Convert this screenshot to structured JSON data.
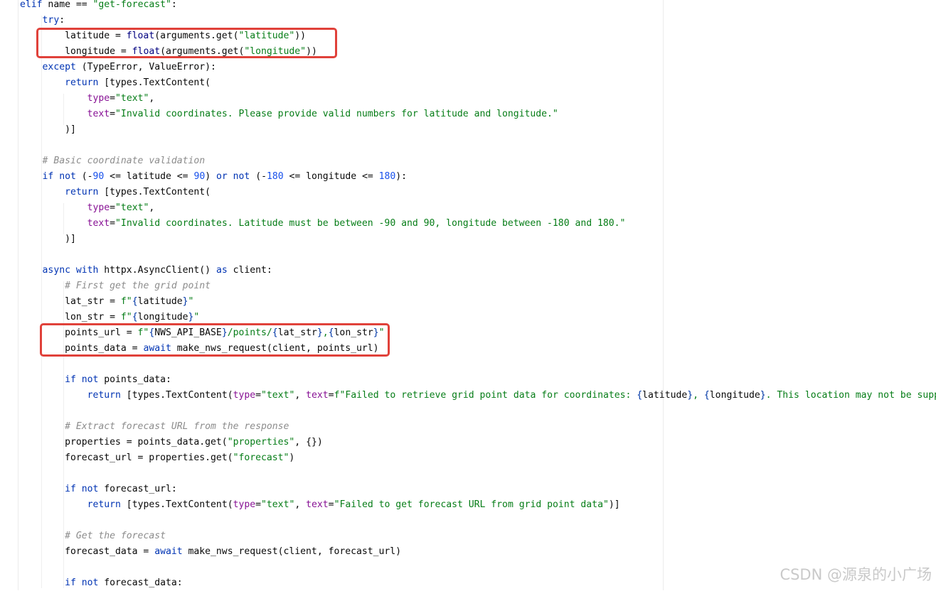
{
  "colors": {
    "keyword": "#0033b3",
    "string": "#067d17",
    "number": "#1750eb",
    "comment": "#8c8c8c",
    "kwarg": "#871094",
    "highlight_box": "#e0413a"
  },
  "code": [
    [
      {
        "t": "elif",
        "c": "kw"
      },
      {
        "t": " name == "
      },
      {
        "t": "\"get-forecast\"",
        "c": "str"
      },
      {
        "t": ":"
      }
    ],
    [
      {
        "t": "    "
      },
      {
        "t": "try",
        "c": "kw"
      },
      {
        "t": ":"
      }
    ],
    [
      {
        "t": "        latitude = "
      },
      {
        "t": "float",
        "c": "builtin"
      },
      {
        "t": "(arguments.get("
      },
      {
        "t": "\"latitude\"",
        "c": "str"
      },
      {
        "t": "))"
      }
    ],
    [
      {
        "t": "        longitude = "
      },
      {
        "t": "float",
        "c": "builtin"
      },
      {
        "t": "(arguments.get("
      },
      {
        "t": "\"longitude\"",
        "c": "str"
      },
      {
        "t": "))"
      }
    ],
    [
      {
        "t": "    "
      },
      {
        "t": "except",
        "c": "kw"
      },
      {
        "t": " (TypeError, ValueError):"
      }
    ],
    [
      {
        "t": "        "
      },
      {
        "t": "return",
        "c": "kw"
      },
      {
        "t": " [types.TextContent("
      }
    ],
    [
      {
        "t": "            "
      },
      {
        "t": "type",
        "c": "kwarg"
      },
      {
        "t": "="
      },
      {
        "t": "\"text\"",
        "c": "str"
      },
      {
        "t": ","
      }
    ],
    [
      {
        "t": "            "
      },
      {
        "t": "text",
        "c": "kwarg"
      },
      {
        "t": "="
      },
      {
        "t": "\"Invalid coordinates. Please provide valid numbers for latitude and longitude.\"",
        "c": "str"
      }
    ],
    [
      {
        "t": "        )]"
      }
    ],
    [
      {
        "t": ""
      }
    ],
    [
      {
        "t": "    "
      },
      {
        "t": "# Basic coordinate validation",
        "c": "cmt"
      }
    ],
    [
      {
        "t": "    "
      },
      {
        "t": "if not",
        "c": "kw"
      },
      {
        "t": " (-"
      },
      {
        "t": "90",
        "c": "num"
      },
      {
        "t": " <= latitude <= "
      },
      {
        "t": "90",
        "c": "num"
      },
      {
        "t": ") "
      },
      {
        "t": "or not",
        "c": "kw"
      },
      {
        "t": " (-"
      },
      {
        "t": "180",
        "c": "num"
      },
      {
        "t": " <= longitude <= "
      },
      {
        "t": "180",
        "c": "num"
      },
      {
        "t": "):"
      }
    ],
    [
      {
        "t": "        "
      },
      {
        "t": "return",
        "c": "kw"
      },
      {
        "t": " [types.TextContent("
      }
    ],
    [
      {
        "t": "            "
      },
      {
        "t": "type",
        "c": "kwarg"
      },
      {
        "t": "="
      },
      {
        "t": "\"text\"",
        "c": "str"
      },
      {
        "t": ","
      }
    ],
    [
      {
        "t": "            "
      },
      {
        "t": "text",
        "c": "kwarg"
      },
      {
        "t": "="
      },
      {
        "t": "\"Invalid coordinates. Latitude must be between -90 and 90, longitude between -180 and 180.\"",
        "c": "str"
      }
    ],
    [
      {
        "t": "        )]"
      }
    ],
    [
      {
        "t": ""
      }
    ],
    [
      {
        "t": "    "
      },
      {
        "t": "async with",
        "c": "kw"
      },
      {
        "t": " httpx.AsyncClient() "
      },
      {
        "t": "as",
        "c": "kw"
      },
      {
        "t": " client:"
      }
    ],
    [
      {
        "t": "        "
      },
      {
        "t": "# First get the grid point",
        "c": "cmt"
      }
    ],
    [
      {
        "t": "        lat_str = "
      },
      {
        "t": "f\"",
        "c": "str"
      },
      {
        "t": "{",
        "c": "brace"
      },
      {
        "t": "latitude"
      },
      {
        "t": "}",
        "c": "brace"
      },
      {
        "t": "\"",
        "c": "str"
      }
    ],
    [
      {
        "t": "        lon_str = "
      },
      {
        "t": "f\"",
        "c": "str"
      },
      {
        "t": "{",
        "c": "brace"
      },
      {
        "t": "longitude"
      },
      {
        "t": "}",
        "c": "brace"
      },
      {
        "t": "\"",
        "c": "str"
      }
    ],
    [
      {
        "t": "        points_url = "
      },
      {
        "t": "f\"",
        "c": "str"
      },
      {
        "t": "{",
        "c": "brace"
      },
      {
        "t": "NWS_API_BASE"
      },
      {
        "t": "}",
        "c": "brace"
      },
      {
        "t": "/points/",
        "c": "str"
      },
      {
        "t": "{",
        "c": "brace"
      },
      {
        "t": "lat_str"
      },
      {
        "t": "}",
        "c": "brace"
      },
      {
        "t": ",",
        "c": "str"
      },
      {
        "t": "{",
        "c": "brace"
      },
      {
        "t": "lon_str"
      },
      {
        "t": "}",
        "c": "brace"
      },
      {
        "t": "\"",
        "c": "str"
      }
    ],
    [
      {
        "t": "        points_data = "
      },
      {
        "t": "await",
        "c": "kw"
      },
      {
        "t": " make_nws_request(client, points_url)"
      }
    ],
    [
      {
        "t": ""
      }
    ],
    [
      {
        "t": "        "
      },
      {
        "t": "if not",
        "c": "kw"
      },
      {
        "t": " points_data:"
      }
    ],
    [
      {
        "t": "            "
      },
      {
        "t": "return",
        "c": "kw"
      },
      {
        "t": " [types.TextContent("
      },
      {
        "t": "type",
        "c": "kwarg"
      },
      {
        "t": "="
      },
      {
        "t": "\"text\"",
        "c": "str"
      },
      {
        "t": ", "
      },
      {
        "t": "text",
        "c": "kwarg"
      },
      {
        "t": "="
      },
      {
        "t": "f\"Failed to retrieve grid point data for coordinates: ",
        "c": "str"
      },
      {
        "t": "{",
        "c": "brace"
      },
      {
        "t": "latitude"
      },
      {
        "t": "}",
        "c": "brace"
      },
      {
        "t": ", ",
        "c": "str"
      },
      {
        "t": "{",
        "c": "brace"
      },
      {
        "t": "longitude"
      },
      {
        "t": "}",
        "c": "brace"
      },
      {
        "t": ". This location may not be suppo",
        "c": "str"
      }
    ],
    [
      {
        "t": ""
      }
    ],
    [
      {
        "t": "        "
      },
      {
        "t": "# Extract forecast URL from the response",
        "c": "cmt"
      }
    ],
    [
      {
        "t": "        properties = points_data.get("
      },
      {
        "t": "\"properties\"",
        "c": "str"
      },
      {
        "t": ", {})"
      }
    ],
    [
      {
        "t": "        forecast_url = properties.get("
      },
      {
        "t": "\"forecast\"",
        "c": "str"
      },
      {
        "t": ")"
      }
    ],
    [
      {
        "t": ""
      }
    ],
    [
      {
        "t": "        "
      },
      {
        "t": "if not",
        "c": "kw"
      },
      {
        "t": " forecast_url:"
      }
    ],
    [
      {
        "t": "            "
      },
      {
        "t": "return",
        "c": "kw"
      },
      {
        "t": " [types.TextContent("
      },
      {
        "t": "type",
        "c": "kwarg"
      },
      {
        "t": "="
      },
      {
        "t": "\"text\"",
        "c": "str"
      },
      {
        "t": ", "
      },
      {
        "t": "text",
        "c": "kwarg"
      },
      {
        "t": "="
      },
      {
        "t": "\"Failed to get forecast URL from grid point data\"",
        "c": "str"
      },
      {
        "t": ")]"
      }
    ],
    [
      {
        "t": ""
      }
    ],
    [
      {
        "t": "        "
      },
      {
        "t": "# Get the forecast",
        "c": "cmt"
      }
    ],
    [
      {
        "t": "        forecast_data = "
      },
      {
        "t": "await",
        "c": "kw"
      },
      {
        "t": " make_nws_request(client, forecast_url)"
      }
    ],
    [
      {
        "t": ""
      }
    ],
    [
      {
        "t": "        "
      },
      {
        "t": "if not",
        "c": "kw"
      },
      {
        "t": " forecast_data:"
      }
    ]
  ],
  "watermark": "CSDN @源泉的小广场"
}
